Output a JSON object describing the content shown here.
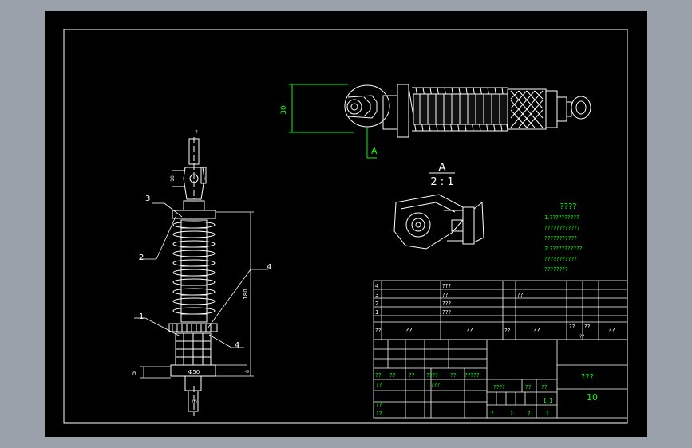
{
  "colors": {
    "background": "#9aa1ab",
    "sheet": "#000000",
    "line": "#ffffff",
    "dimension": "#00ff00",
    "note_text": "#00ff00",
    "table_text": "#ffffff"
  },
  "views": {
    "top_dim": "30",
    "section_label": "A",
    "detail_label": "A",
    "detail_scale": "2 : 1",
    "left_dims": {
      "top": "7",
      "side": "10",
      "height": "180",
      "body": "Φ50",
      "bottom": "10",
      "base_h": "8",
      "base_left": "5"
    },
    "callouts": [
      "3",
      "2",
      "4",
      "1",
      "4"
    ]
  },
  "notes": {
    "title": "????",
    "lines": [
      "1.??????????",
      "????????????",
      "???????????",
      "2.???????????",
      "???????????",
      "????????"
    ]
  },
  "parts_list": {
    "rows": [
      {
        "no": "4",
        "c1": "",
        "c2": "???",
        "c3": "",
        "c4": ""
      },
      {
        "no": "3",
        "c1": "",
        "c2": "??",
        "c3": "??",
        "c4": ""
      },
      {
        "no": "2",
        "c1": "",
        "c2": "???",
        "c3": "",
        "c4": ""
      },
      {
        "no": "1",
        "c1": "",
        "c2": "???",
        "c3": "",
        "c4": ""
      }
    ],
    "header": [
      "??",
      "??",
      "??",
      "??",
      "??",
      "??",
      "??",
      "??"
    ],
    "header_sub": "??"
  },
  "title_block": {
    "sign_row": [
      "??",
      "??",
      "??",
      "????",
      "??",
      "?????"
    ],
    "left_rows": [
      "??",
      "??",
      "??"
    ],
    "process": "???",
    "stage_labels": [
      "????",
      "??",
      "??"
    ],
    "scale": "1:1",
    "bottom": [
      "?",
      "?",
      "?",
      "?"
    ],
    "drawing_name": "???",
    "drawing_no": "10"
  }
}
